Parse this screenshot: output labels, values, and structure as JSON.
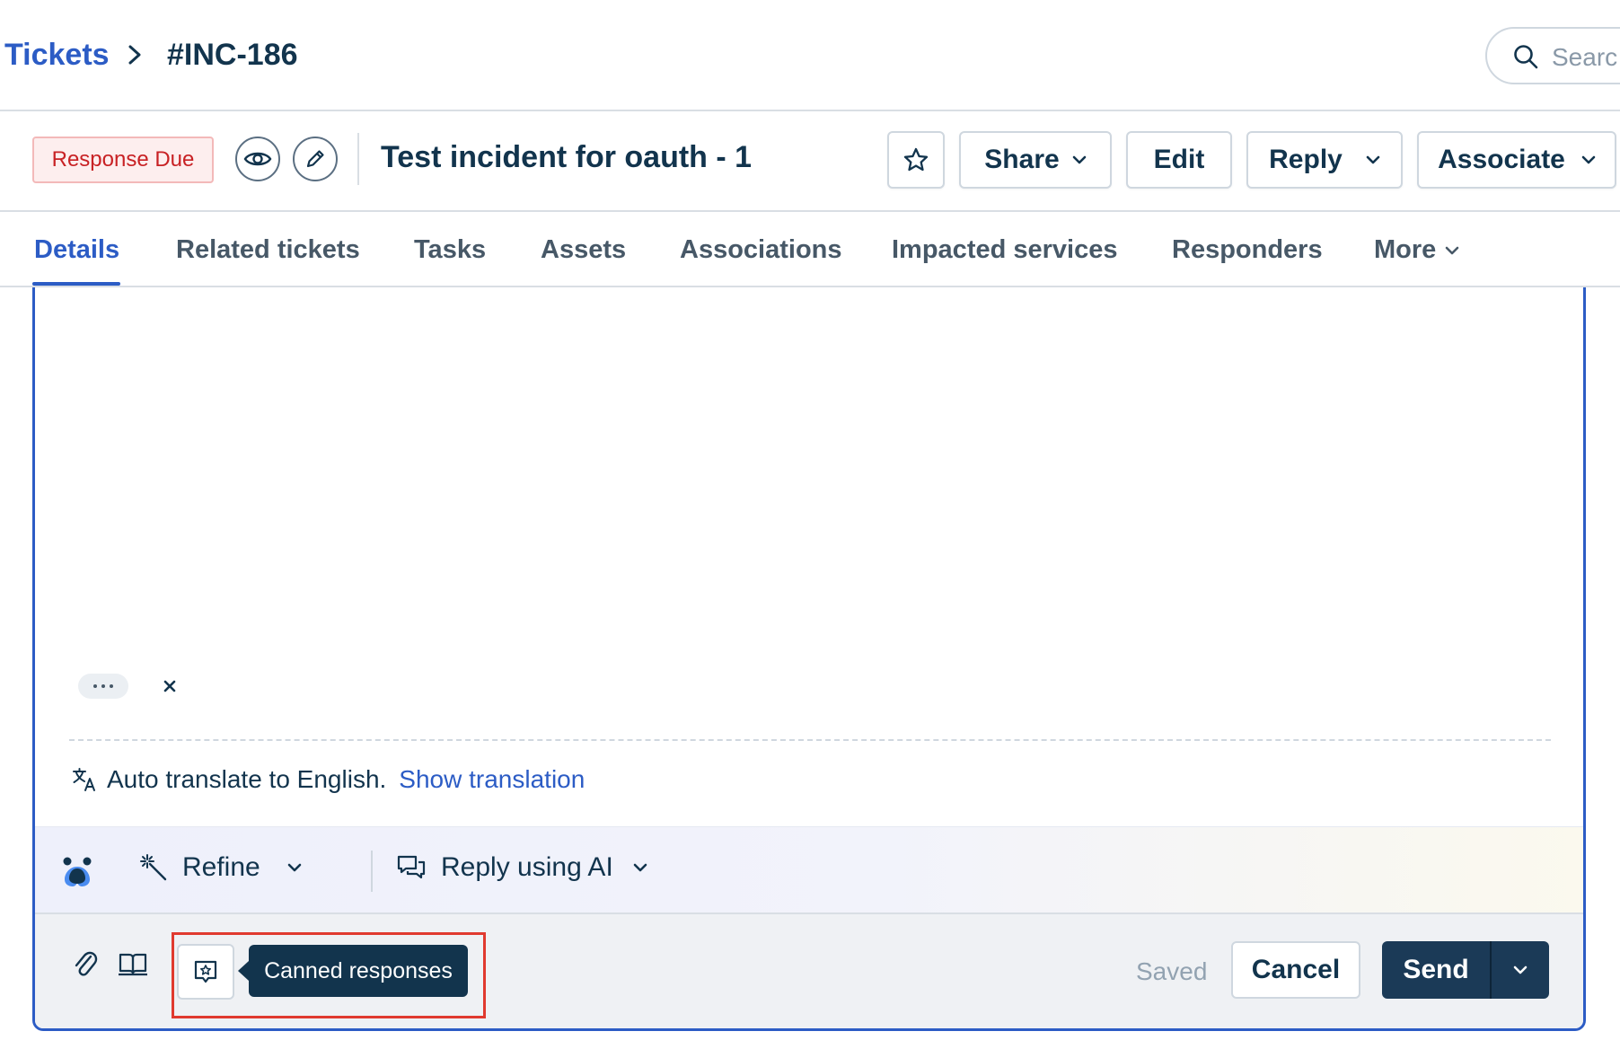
{
  "breadcrumb": {
    "root": "Tickets",
    "current": "#INC-186"
  },
  "search": {
    "placeholder": "Searc"
  },
  "ticket": {
    "status_badge": "Response Due",
    "title": "Test incident for oauth - 1",
    "actions": {
      "share": "Share",
      "edit": "Edit",
      "reply": "Reply",
      "associate": "Associate"
    }
  },
  "tabs": [
    {
      "label": "Details",
      "active": true
    },
    {
      "label": "Related tickets"
    },
    {
      "label": "Tasks"
    },
    {
      "label": "Assets"
    },
    {
      "label": "Associations"
    },
    {
      "label": "Impacted services"
    },
    {
      "label": "Responders"
    },
    {
      "label": "More"
    }
  ],
  "editor": {
    "translate_text": "Auto translate to English.",
    "translate_link": "Show translation"
  },
  "ai_bar": {
    "refine": "Refine",
    "reply_ai": "Reply using AI"
  },
  "footer": {
    "tooltip": "Canned responses",
    "saved": "Saved",
    "cancel": "Cancel",
    "send": "Send"
  },
  "colors": {
    "accent": "#2c5cc5",
    "primary_dark": "#12344d",
    "badge_red": "#c82124",
    "highlight": "#e03a2f"
  },
  "icons": [
    "chevron-right-icon",
    "search-icon",
    "eye-icon",
    "pencil-icon",
    "star-icon",
    "chevron-down-icon",
    "more-icon",
    "close-icon",
    "translate-icon",
    "ai-logo-icon",
    "magic-wand-icon",
    "chat-icon",
    "paperclip-icon",
    "book-icon",
    "canned-response-icon"
  ]
}
